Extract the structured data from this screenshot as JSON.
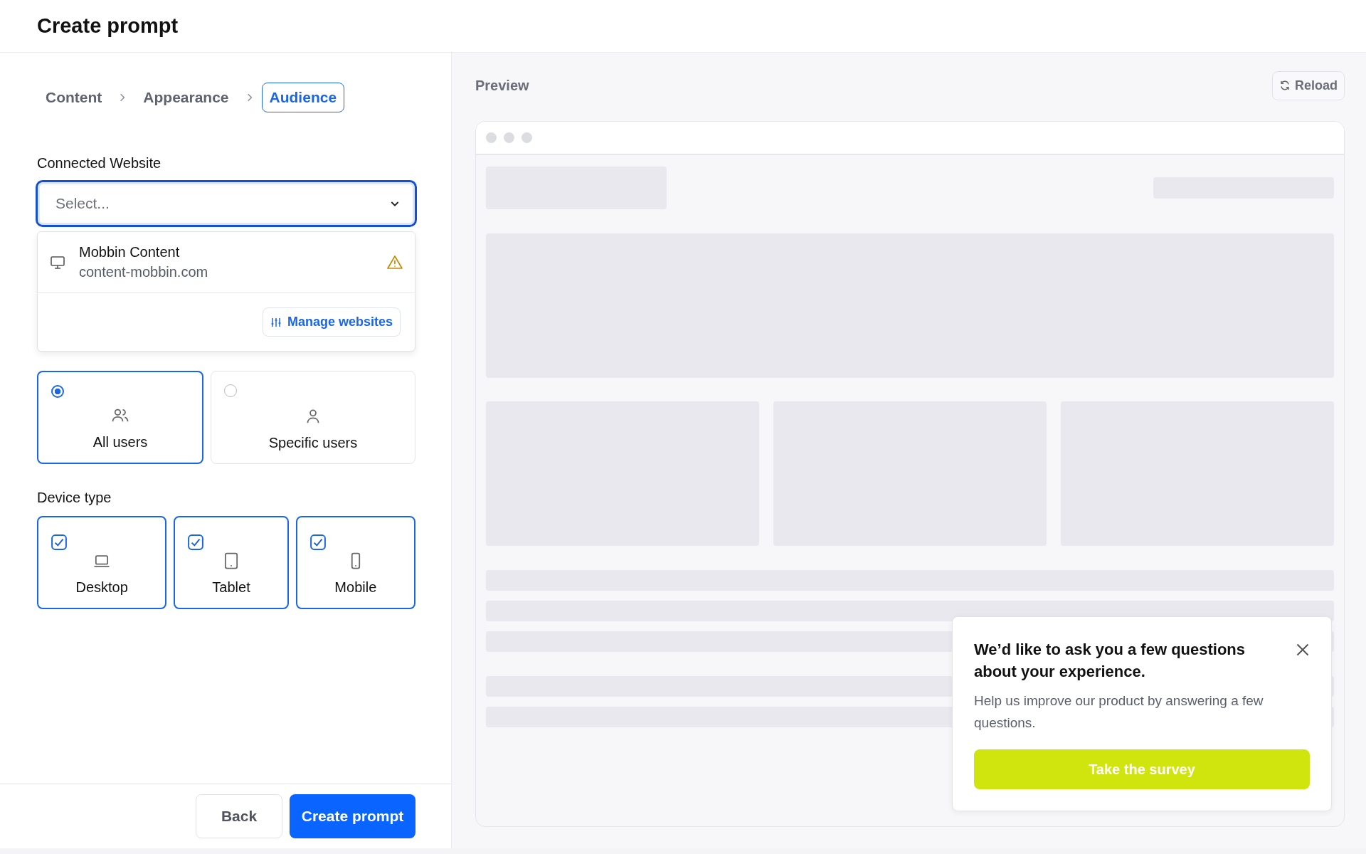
{
  "header": {
    "title": "Create prompt"
  },
  "steps": [
    {
      "label": "Content",
      "selected": false
    },
    {
      "label": "Appearance",
      "selected": false
    },
    {
      "label": "Audience",
      "selected": true
    }
  ],
  "connected_website": {
    "label": "Connected Website",
    "placeholder": "Select...",
    "expanded": true,
    "options": [
      {
        "name": "Mobbin Content",
        "domain": "content-mobbin.com",
        "warning": true
      }
    ],
    "manage_button": "Manage websites"
  },
  "display_to": {
    "options": [
      {
        "kind": "group",
        "label": "All users",
        "selected": true
      },
      {
        "kind": "single",
        "label": "Specific users",
        "selected": false
      }
    ]
  },
  "device_type": {
    "label": "Device type",
    "options": [
      {
        "kind": "desktop",
        "label": "Desktop",
        "checked": true
      },
      {
        "kind": "tablet",
        "label": "Tablet",
        "checked": true
      },
      {
        "kind": "mobile",
        "label": "Mobile",
        "checked": true
      }
    ]
  },
  "footer": {
    "back": "Back",
    "submit": "Create prompt"
  },
  "preview": {
    "title": "Preview",
    "reload": "Reload"
  },
  "survey": {
    "title": "We’d like to ask you a few questions about your experience.",
    "body": "Help us improve our product by answering a few questions.",
    "button": "Take the survey"
  }
}
